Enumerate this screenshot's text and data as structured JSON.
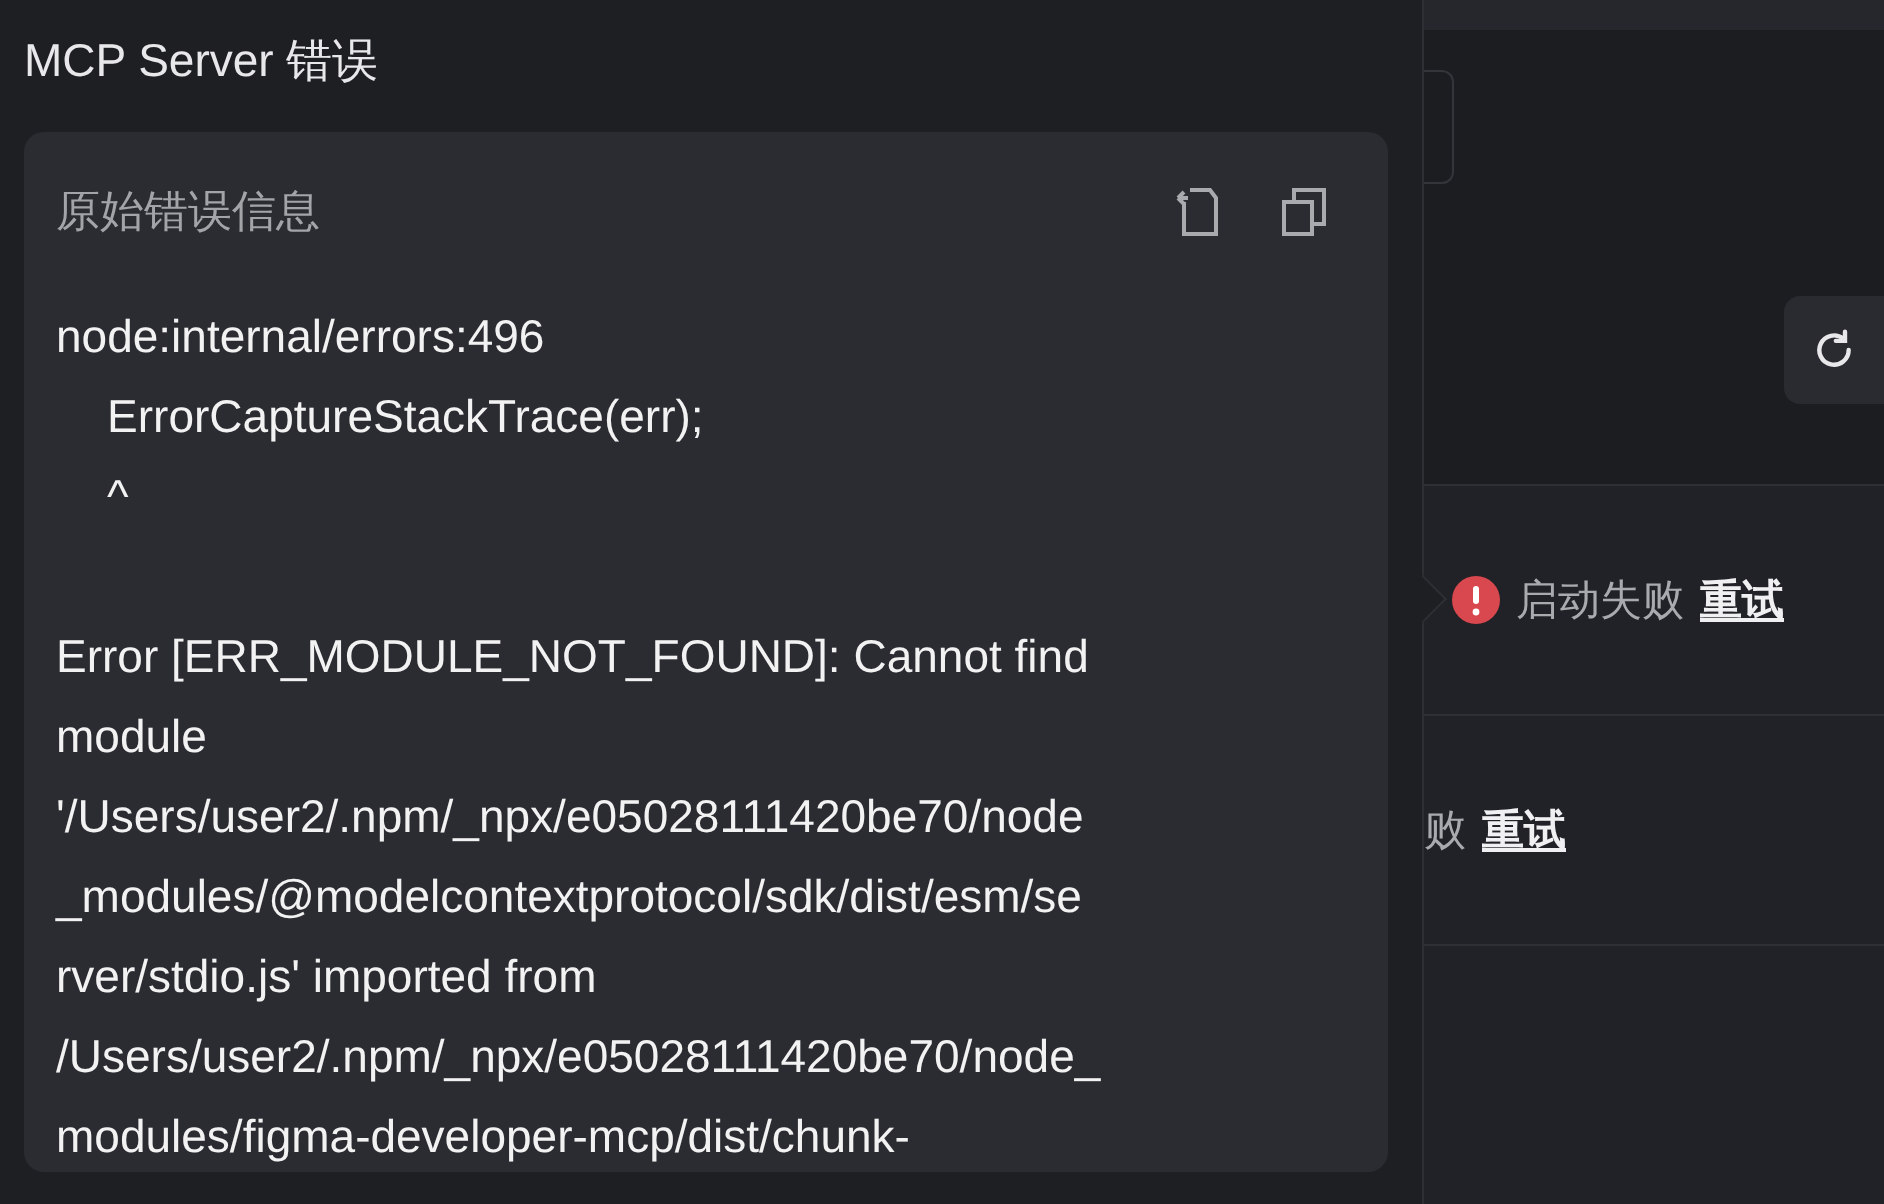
{
  "dialog": {
    "title": "MCP Server 错误",
    "card": {
      "title": "原始错误信息",
      "paragraphs": [
        [
          "node:internal/errors:496",
          "    ErrorCaptureStackTrace(err);",
          "    ^"
        ],
        [
          "Error [ERR_MODULE_NOT_FOUND]: Cannot find",
          "module",
          "'/Users/user2/.npm/_npx/e05028111420be70/node",
          "_modules/@modelcontextprotocol/sdk/dist/esm/se",
          "rver/stdio.js' imported from",
          "/Users/user2/.npm/_npx/e05028111420be70/node_",
          "modules/figma-developer-mcp/dist/chunk-"
        ]
      ]
    }
  },
  "server_rows": [
    {
      "status": "启动失败",
      "error": true,
      "action": "重试"
    },
    {
      "status": "败",
      "error": false,
      "action": "重试"
    }
  ]
}
